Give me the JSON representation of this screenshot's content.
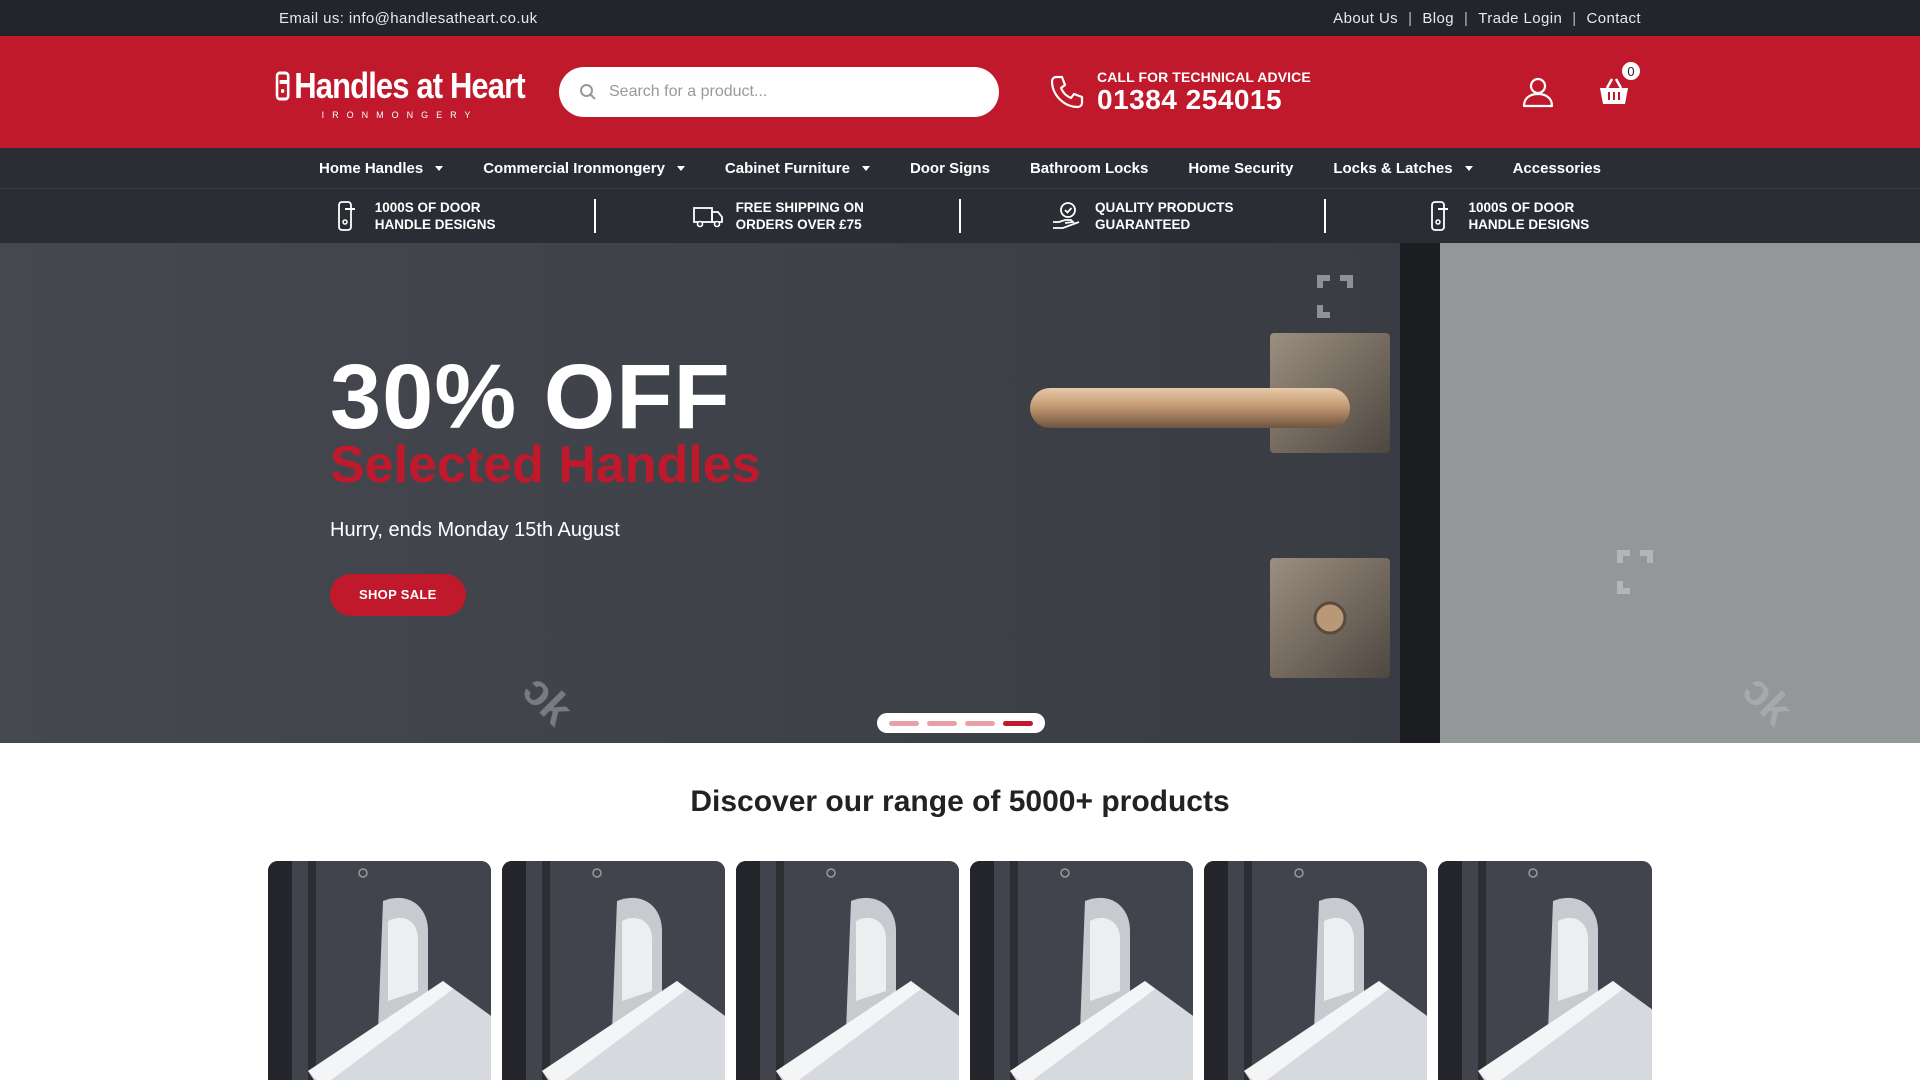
{
  "topbar": {
    "email": "Email us: info@handlesatheart.co.uk",
    "links": [
      "About Us",
      "Blog",
      "Trade Login",
      "Contact"
    ]
  },
  "header": {
    "logo_title": "Handles at Heart",
    "logo_subtitle": "IRONMONGERY",
    "search_placeholder": "Search for a product...",
    "advice_label": "CALL FOR TECHNICAL ADVICE",
    "phone": "01384 254015",
    "cart_count": "0"
  },
  "nav": {
    "items": [
      {
        "label": "Home Handles",
        "dropdown": true
      },
      {
        "label": "Commercial Ironmongery",
        "dropdown": true
      },
      {
        "label": "Cabinet Furniture",
        "dropdown": true
      },
      {
        "label": "Door Signs",
        "dropdown": false
      },
      {
        "label": "Bathroom Locks",
        "dropdown": false
      },
      {
        "label": "Home Security",
        "dropdown": false
      },
      {
        "label": "Locks & Latches",
        "dropdown": true
      },
      {
        "label": "Accessories",
        "dropdown": false
      }
    ]
  },
  "usp": [
    {
      "icon": "door-handle-icon",
      "line1": "1000S OF DOOR",
      "line2": "HANDLE DESIGNS"
    },
    {
      "icon": "truck-icon",
      "line1": "FREE SHIPPING ON",
      "line2": "ORDERS OVER £75"
    },
    {
      "icon": "quality-badge-icon",
      "line1": "QUALITY PRODUCTS",
      "line2": "GUARANTEED"
    },
    {
      "icon": "door-handle-icon",
      "line1": "1000S OF DOOR",
      "line2": "HANDLE DESIGNS"
    }
  ],
  "hero": {
    "headline": "30% OFF",
    "subheadline": "Selected Handles",
    "tagline": "Hurry, ends Monday 15th August",
    "cta": "SHOP SALE",
    "slides": 4,
    "active_slide": 4
  },
  "section": {
    "title": "Discover our range of 5000+ products"
  },
  "colors": {
    "brand_red": "#c0192c",
    "dark": "#2a2d33",
    "topbar": "#22252b"
  }
}
